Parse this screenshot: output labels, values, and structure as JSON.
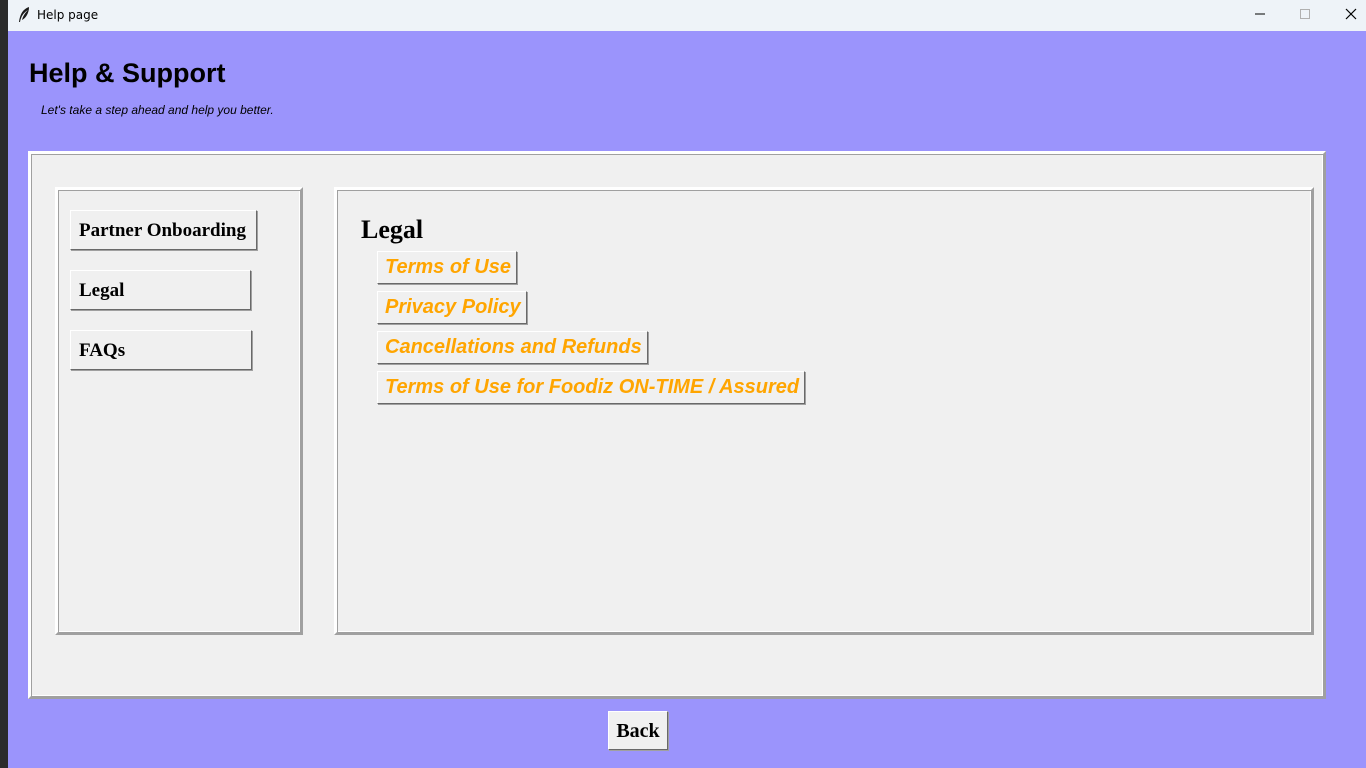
{
  "window": {
    "title": "Help page",
    "icon": "feather-icon",
    "controls": [
      "minimize-icon",
      "maximize-icon",
      "close-icon"
    ]
  },
  "header": {
    "title": "Help & Support",
    "subtitle": "Let's take a step ahead and help you better."
  },
  "sidebar": {
    "items": [
      {
        "label": "Partner Onboarding"
      },
      {
        "label": "Legal"
      },
      {
        "label": "FAQs"
      }
    ]
  },
  "main": {
    "heading": "Legal",
    "links": [
      {
        "label": "Terms of Use"
      },
      {
        "label": "Privacy Policy"
      },
      {
        "label": "Cancellations and Refunds"
      },
      {
        "label": "Terms of Use for Foodiz ON-TIME / Assured"
      }
    ]
  },
  "footer": {
    "back_label": "Back"
  },
  "colors": {
    "background": "#9b94fc",
    "panel": "#f0f0f0",
    "link": "#ffa500"
  }
}
